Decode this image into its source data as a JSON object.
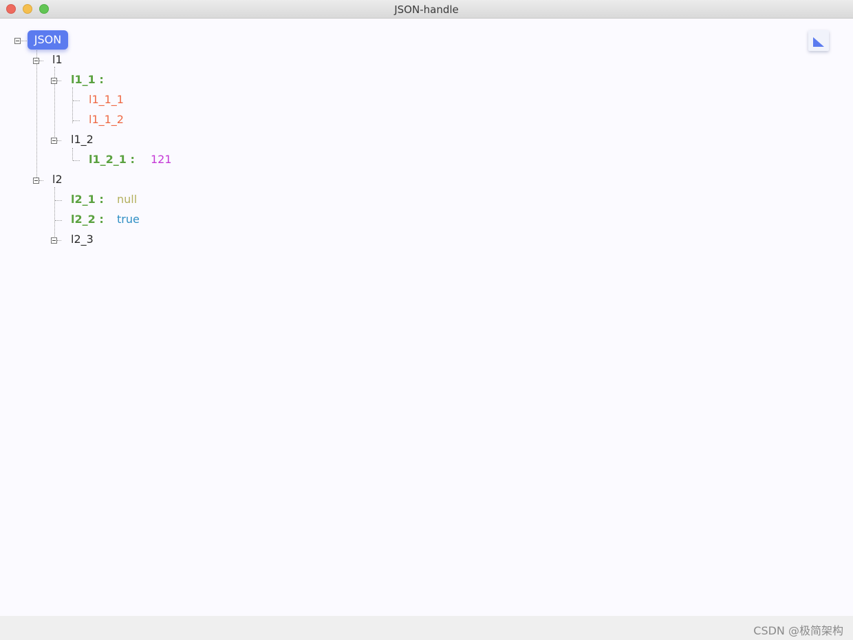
{
  "window": {
    "title": "JSON-handle"
  },
  "footer": {
    "watermark": "CSDN @极简架构"
  },
  "tree": {
    "root": "JSON",
    "l1": "l1",
    "l1_1_key": "l1_1 :",
    "l1_1_1": "l1_1_1",
    "l1_1_2": "l1_1_2",
    "l1_2": "l1_2",
    "l1_2_1_key": "l1_2_1 :",
    "l1_2_1_value": "121",
    "l2": "l2",
    "l2_1_key": "l2_1 :",
    "l2_1_value": "null",
    "l2_2_key": "l2_2 :",
    "l2_2_value": "true",
    "l2_3": "l2_3"
  },
  "colors": {
    "root_chip": "#5b7bef",
    "key": "#5aa13f",
    "string": "#ee6a45",
    "number": "#c438d6",
    "null": "#b3b05e",
    "boolean": "#2f8fc4"
  },
  "icons": {
    "corner": "collapse-corner-icon",
    "toggle": "minus-box-icon"
  }
}
